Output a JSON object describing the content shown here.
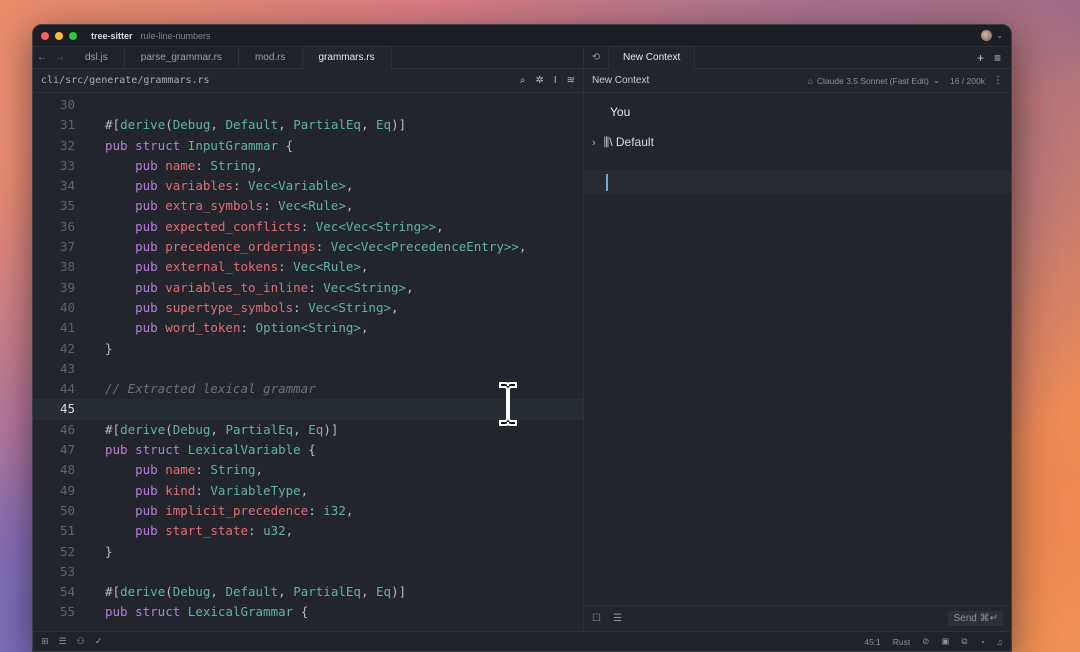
{
  "window": {
    "project": "tree-sitter",
    "branch": "rule-line-numbers"
  },
  "editor_tabs": [
    {
      "label": "dsl.js",
      "active": false
    },
    {
      "label": "parse_grammar.rs",
      "active": false
    },
    {
      "label": "mod.rs",
      "active": false
    },
    {
      "label": "grammars.rs",
      "active": true
    }
  ],
  "context_tab": {
    "label": "New Context"
  },
  "breadcrumb": {
    "path": "cli/src/generate/grammars.rs"
  },
  "code_lines": [
    {
      "n": "30",
      "html": ""
    },
    {
      "n": "31",
      "html": "<span class='pn'>#[</span><span class='ty'>derive</span><span class='pn'>(</span><span class='ty'>Debug</span><span class='pn'>, </span><span class='ty'>Default</span><span class='pn'>, </span><span class='ty'>PartialEq</span><span class='pn'>, </span><span class='ty'>Eq</span><span class='pn'>)]</span>"
    },
    {
      "n": "32",
      "html": "<span class='kw'>pub struct</span> <span class='ty'>InputGrammar</span> <span class='pn'>{</span>"
    },
    {
      "n": "33",
      "html": "    <span class='kw'>pub</span> <span class='fld'>name</span><span class='pn'>: </span><span class='ty'>String</span><span class='pn'>,</span>"
    },
    {
      "n": "34",
      "html": "    <span class='kw'>pub</span> <span class='fld'>variables</span><span class='pn'>: </span><span class='ty'>Vec&lt;Variable&gt;</span><span class='pn'>,</span>"
    },
    {
      "n": "35",
      "html": "    <span class='kw'>pub</span> <span class='fld'>extra_symbols</span><span class='pn'>: </span><span class='ty'>Vec&lt;Rule&gt;</span><span class='pn'>,</span>"
    },
    {
      "n": "36",
      "html": "    <span class='kw'>pub</span> <span class='fld'>expected_conflicts</span><span class='pn'>: </span><span class='ty'>Vec&lt;Vec&lt;String&gt;&gt;</span><span class='pn'>,</span>"
    },
    {
      "n": "37",
      "html": "    <span class='kw'>pub</span> <span class='fld'>precedence_orderings</span><span class='pn'>: </span><span class='ty'>Vec&lt;Vec&lt;PrecedenceEntry&gt;&gt;</span><span class='pn'>,</span>"
    },
    {
      "n": "38",
      "html": "    <span class='kw'>pub</span> <span class='fld'>external_tokens</span><span class='pn'>: </span><span class='ty'>Vec&lt;Rule&gt;</span><span class='pn'>,</span>"
    },
    {
      "n": "39",
      "html": "    <span class='kw'>pub</span> <span class='fld'>variables_to_inline</span><span class='pn'>: </span><span class='ty'>Vec&lt;String&gt;</span><span class='pn'>,</span>"
    },
    {
      "n": "40",
      "html": "    <span class='kw'>pub</span> <span class='fld'>supertype_symbols</span><span class='pn'>: </span><span class='ty'>Vec&lt;String&gt;</span><span class='pn'>,</span>"
    },
    {
      "n": "41",
      "html": "    <span class='kw'>pub</span> <span class='fld'>word_token</span><span class='pn'>: </span><span class='ty'>Option&lt;String&gt;</span><span class='pn'>,</span>"
    },
    {
      "n": "42",
      "html": "<span class='pn'>}</span>"
    },
    {
      "n": "43",
      "html": ""
    },
    {
      "n": "44",
      "html": "<span class='cm'>// Extracted lexical grammar</span>"
    },
    {
      "n": "45",
      "html": "",
      "current": true
    },
    {
      "n": "46",
      "html": "<span class='pn'>#[</span><span class='ty'>derive</span><span class='pn'>(</span><span class='ty'>Debug</span><span class='pn'>, </span><span class='ty'>PartialEq</span><span class='pn'>, </span><span class='ty'>Eq</span><span class='pn'>)]</span>"
    },
    {
      "n": "47",
      "html": "<span class='kw'>pub struct</span> <span class='ty'>LexicalVariable</span> <span class='pn'>{</span>"
    },
    {
      "n": "48",
      "html": "    <span class='kw'>pub</span> <span class='fld'>name</span><span class='pn'>: </span><span class='ty'>String</span><span class='pn'>,</span>"
    },
    {
      "n": "49",
      "html": "    <span class='kw'>pub</span> <span class='fld'>kind</span><span class='pn'>: </span><span class='ty'>VariableType</span><span class='pn'>,</span>"
    },
    {
      "n": "50",
      "html": "    <span class='kw'>pub</span> <span class='fld'>implicit_precedence</span><span class='pn'>: </span><span class='ty'>i32</span><span class='pn'>,</span>"
    },
    {
      "n": "51",
      "html": "    <span class='kw'>pub</span> <span class='fld'>start_state</span><span class='pn'>: </span><span class='ty'>u32</span><span class='pn'>,</span>"
    },
    {
      "n": "52",
      "html": "<span class='pn'>}</span>"
    },
    {
      "n": "53",
      "html": ""
    },
    {
      "n": "54",
      "html": "<span class='pn'>#[</span><span class='ty'>derive</span><span class='pn'>(</span><span class='ty'>Debug</span><span class='pn'>, </span><span class='ty'>Default</span><span class='pn'>, </span><span class='ty'>PartialEq</span><span class='pn'>, </span><span class='ty'>Eq</span><span class='pn'>)]</span>"
    },
    {
      "n": "55",
      "html": "<span class='kw'>pub struct</span> <span class='ty'>LexicalGrammar</span> <span class='pn'>{</span>"
    }
  ],
  "assistant": {
    "title": "New Context",
    "model": "Claude 3.5 Sonnet (Fast Edit)",
    "tokens": "16 / 200k",
    "you_label": "You",
    "default_label": "Default",
    "send_label": "Send ⌘↵"
  },
  "statusbar": {
    "position": "45:1",
    "language": "Rust"
  },
  "colors": {
    "keyword": "#b77fd9",
    "type": "#5fb3a8",
    "field": "#e06c75",
    "comment": "#6b717a",
    "accent": "#6ea8e0"
  }
}
